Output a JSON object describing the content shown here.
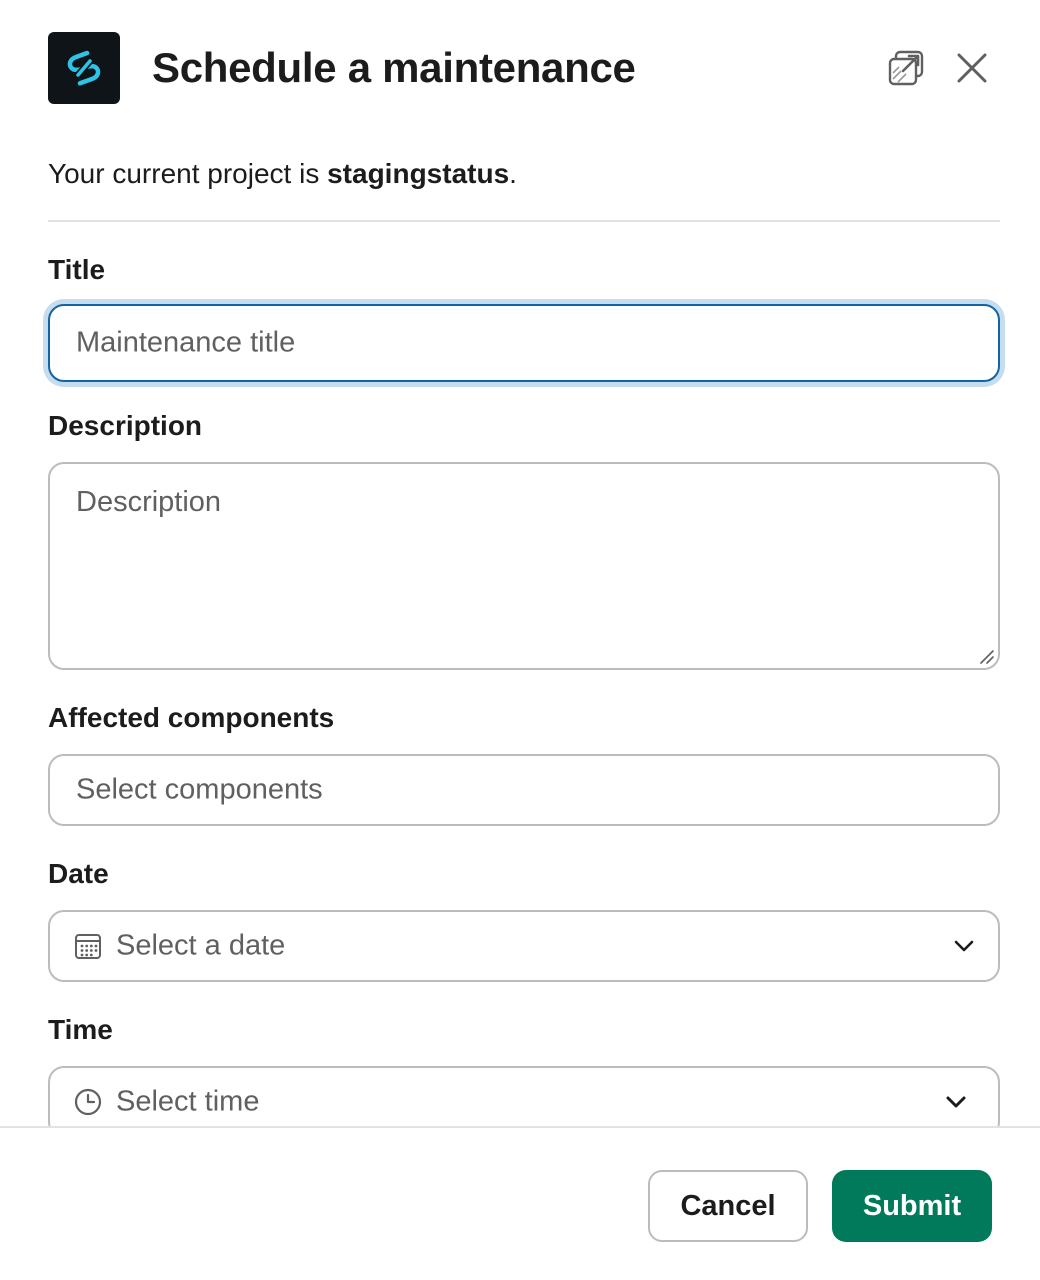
{
  "modal": {
    "title": "Schedule a maintenance",
    "logo_icon": "status-link-logo-icon",
    "popout_icon": "popout-icon",
    "close_icon": "close-icon"
  },
  "context": {
    "prefix": "Your current project is ",
    "project": "stagingstatus",
    "suffix": "."
  },
  "form": {
    "title": {
      "label": "Title",
      "placeholder": "Maintenance title"
    },
    "description": {
      "label": "Description",
      "placeholder": "Description"
    },
    "components": {
      "label": "Affected components",
      "placeholder": "Select components"
    },
    "date": {
      "label": "Date",
      "placeholder": "Select a date",
      "icon": "calendar-icon"
    },
    "time": {
      "label": "Time",
      "placeholder": "Select time",
      "icon": "clock-icon"
    }
  },
  "footer": {
    "cancel_label": "Cancel",
    "submit_label": "Submit"
  },
  "colors": {
    "accent": "#1264a3",
    "submit": "#007a5a",
    "logo_bg": "#0f1419",
    "logo_fg": "#2ec4e6"
  }
}
